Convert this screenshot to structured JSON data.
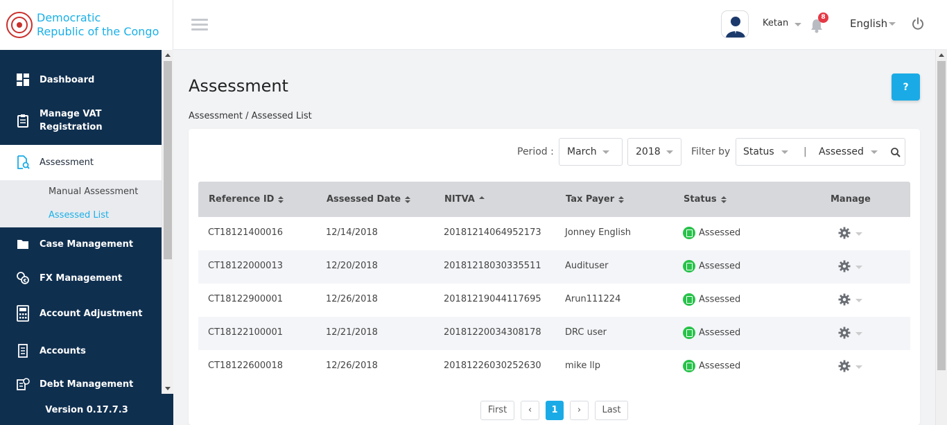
{
  "brand": {
    "name_line1": "Democratic",
    "name_line2": "Republic of the Congo"
  },
  "header": {
    "user_name": "Ketan",
    "notifications_count": "8",
    "language": "English"
  },
  "sidebar": {
    "items": [
      {
        "label": "Dashboard",
        "icon": "dashboard-icon"
      },
      {
        "label": "Manage VAT Registration",
        "icon": "clipboard-icon"
      },
      {
        "label": "Assessment",
        "icon": "document-search-icon"
      },
      {
        "label": "Case Management",
        "icon": "folder-icon"
      },
      {
        "label": "FX Management",
        "icon": "currency-exchange-icon"
      },
      {
        "label": "Account Adjustment",
        "icon": "calculator-icon"
      },
      {
        "label": "Accounts",
        "icon": "receipt-icon"
      },
      {
        "label": "Debt Management",
        "icon": "debt-icon"
      }
    ],
    "subitems": [
      {
        "label": "Manual Assessment"
      },
      {
        "label": "Assessed List"
      }
    ],
    "version": "Version 0.17.7.3"
  },
  "page": {
    "title": "Assessment",
    "help": "?",
    "breadcrumb": "Assessment / Assessed List"
  },
  "filters": {
    "period_label": "Period :",
    "month": "March",
    "year": "2018",
    "filter_label": "Filter by",
    "filter_field": "Status",
    "separator": "|",
    "filter_value": "Assessed"
  },
  "table": {
    "columns": [
      "Reference ID",
      "Assessed Date",
      "NITVA",
      "Tax Payer",
      "Status",
      "Manage"
    ],
    "rows": [
      {
        "ref": "CT18121400016",
        "date": "12/14/2018",
        "nitva": "20181214064952173",
        "payer": "Jonney English",
        "status": "Assessed"
      },
      {
        "ref": "CT18122000013",
        "date": "12/20/2018",
        "nitva": "20181218030335511",
        "payer": "Audituser",
        "status": "Assessed"
      },
      {
        "ref": "CT18122900001",
        "date": "12/26/2018",
        "nitva": "20181219044117695",
        "payer": "Arun111224",
        "status": "Assessed"
      },
      {
        "ref": "CT18122100001",
        "date": "12/21/2018",
        "nitva": "20181220034308178",
        "payer": "DRC user",
        "status": "Assessed"
      },
      {
        "ref": "CT18122600018",
        "date": "12/26/2018",
        "nitva": "20181226030252630",
        "payer": "mike llp",
        "status": "Assessed"
      }
    ]
  },
  "pagination": {
    "first": "First",
    "prev": "‹",
    "current": "1",
    "next": "›",
    "last": "Last"
  },
  "colors": {
    "accent": "#1aabe6",
    "sidebar": "#0f2f4f",
    "status_green": "#28c24a",
    "badge_red": "#e53945"
  }
}
